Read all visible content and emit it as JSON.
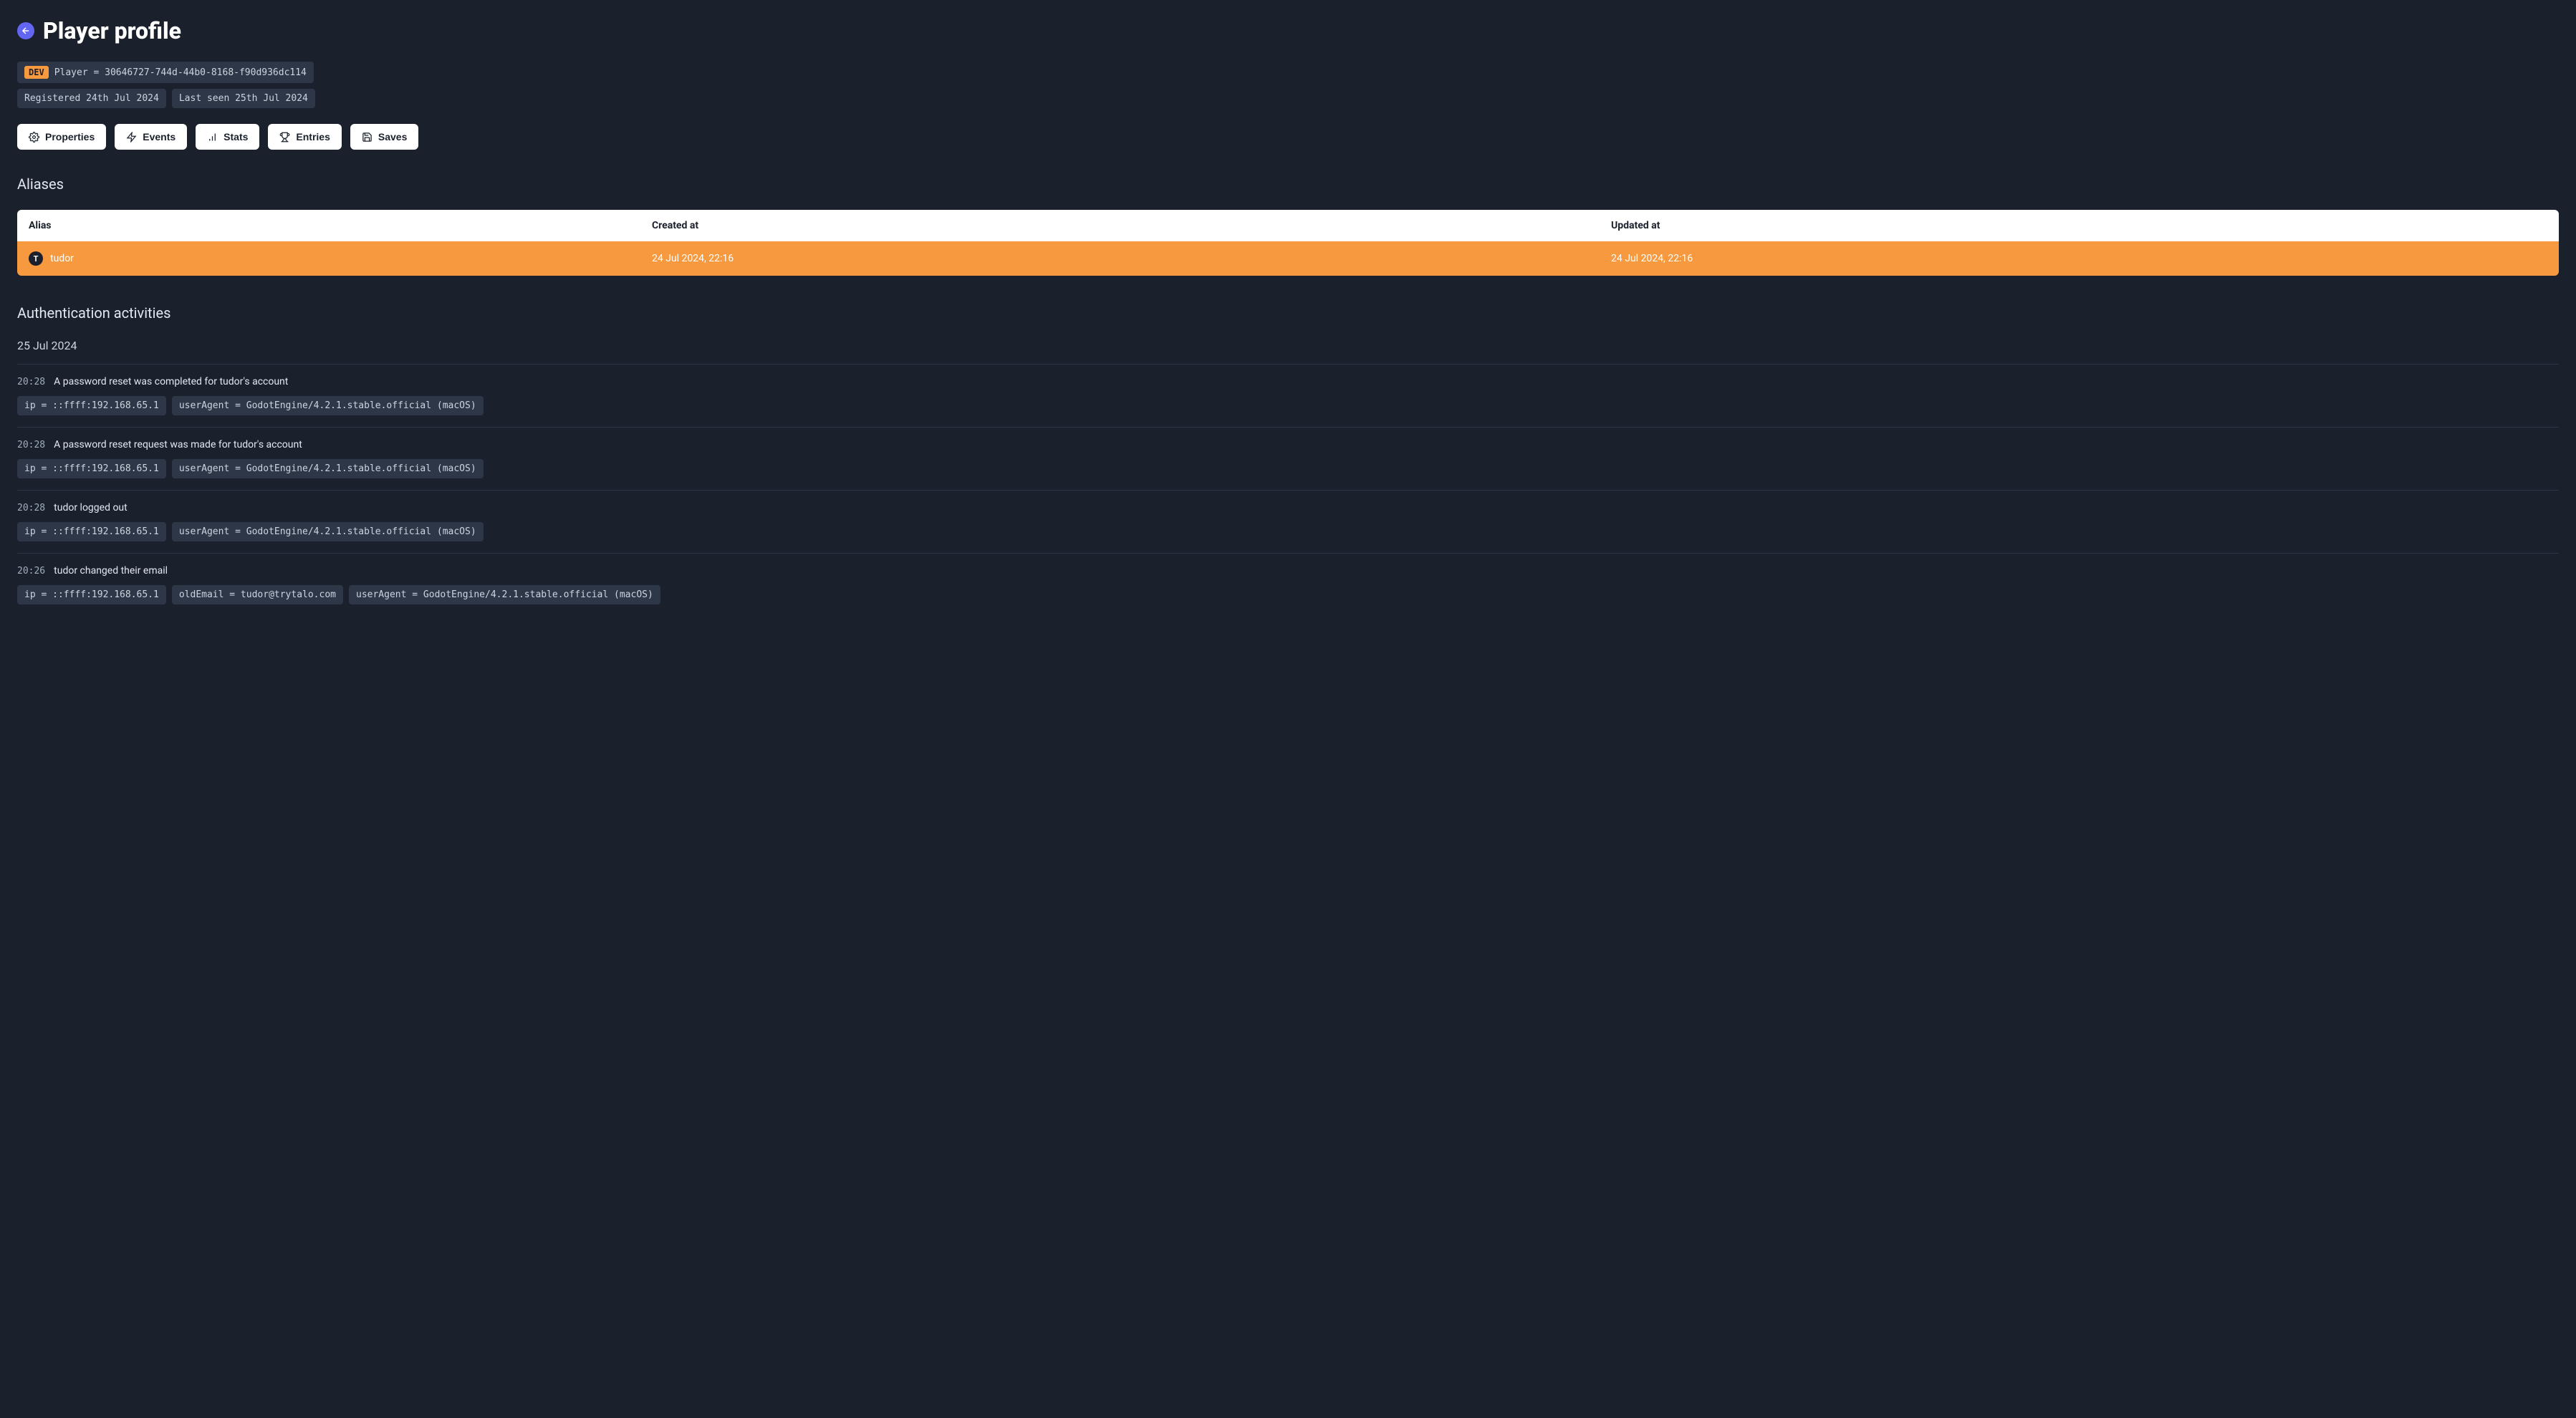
{
  "header": {
    "title": "Player profile",
    "dev_tag": "DEV",
    "player_id_line": "Player = 30646727-744d-44b0-8168-f90d936dc114",
    "registered": "Registered 24th Jul 2024",
    "last_seen": "Last seen 25th Jul 2024"
  },
  "tabs": {
    "properties": "Properties",
    "events": "Events",
    "stats": "Stats",
    "entries": "Entries",
    "saves": "Saves"
  },
  "aliases": {
    "heading": "Aliases",
    "columns": {
      "alias": "Alias",
      "created": "Created at",
      "updated": "Updated at"
    },
    "rows": [
      {
        "name": "tudor",
        "created": "24 Jul 2024, 22:16",
        "updated": "24 Jul 2024, 22:16"
      }
    ]
  },
  "auth": {
    "heading": "Authentication activities",
    "date": "25 Jul 2024",
    "activities": [
      {
        "time": "20:28",
        "desc": "A password reset was completed for tudor's account",
        "tags": [
          "ip = ::ffff:192.168.65.1",
          "userAgent = GodotEngine/4.2.1.stable.official (macOS)"
        ]
      },
      {
        "time": "20:28",
        "desc": "A password reset request was made for tudor's account",
        "tags": [
          "ip = ::ffff:192.168.65.1",
          "userAgent = GodotEngine/4.2.1.stable.official (macOS)"
        ]
      },
      {
        "time": "20:28",
        "desc": "tudor logged out",
        "tags": [
          "ip = ::ffff:192.168.65.1",
          "userAgent = GodotEngine/4.2.1.stable.official (macOS)"
        ]
      },
      {
        "time": "20:26",
        "desc": "tudor changed their email",
        "tags": [
          "ip = ::ffff:192.168.65.1",
          "oldEmail = tudor@trytalo.com",
          "userAgent = GodotEngine/4.2.1.stable.official (macOS)"
        ]
      }
    ]
  }
}
